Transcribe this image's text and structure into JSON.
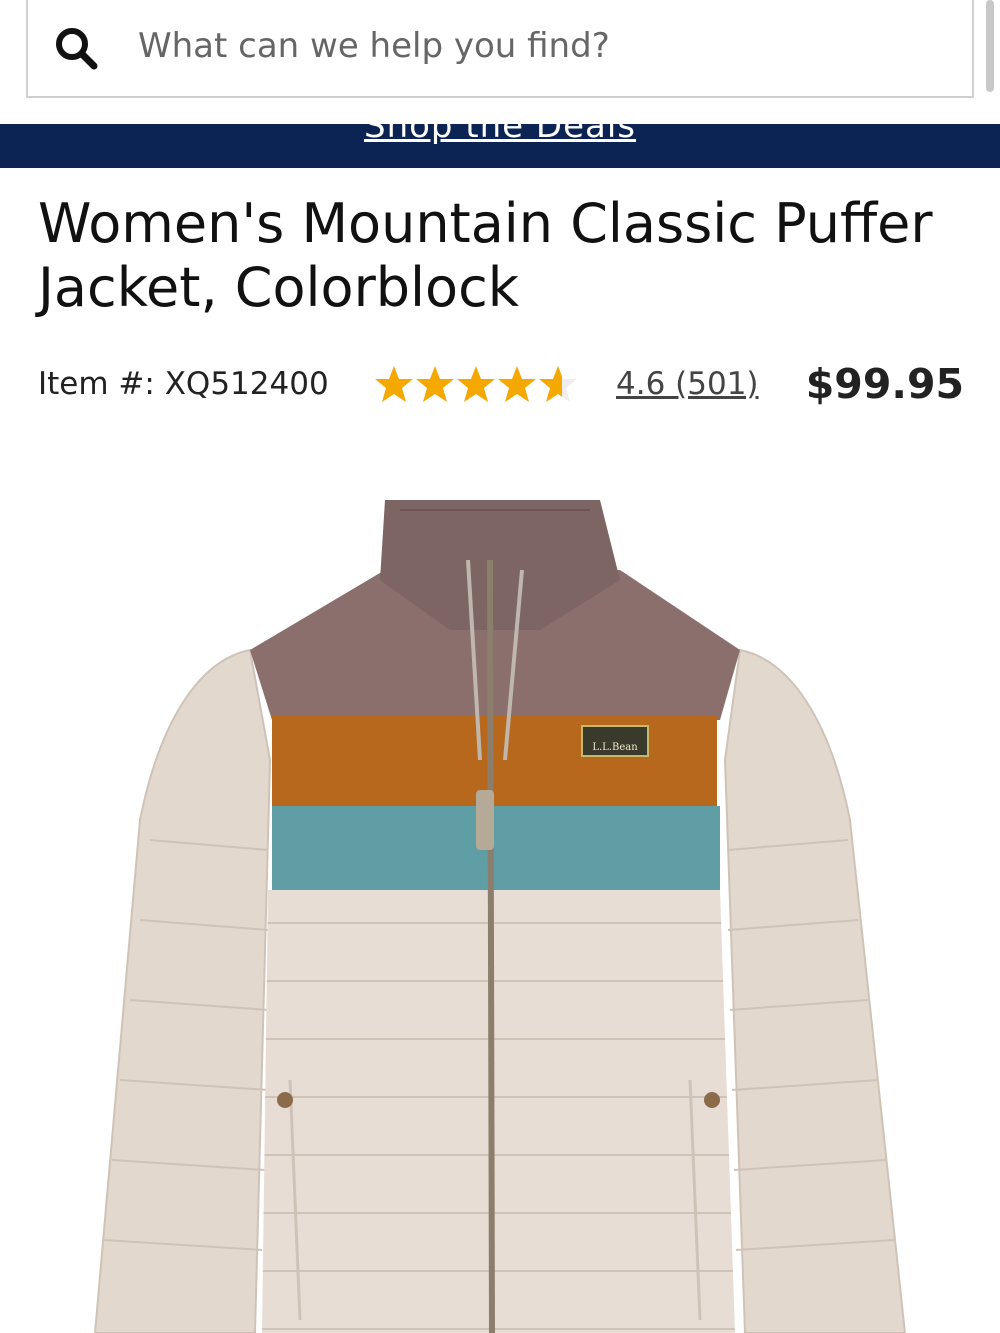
{
  "search": {
    "placeholder": "What can we help you find?",
    "icon": "search-icon"
  },
  "promo_bar": {
    "link_text": "Shop the Deals",
    "background": "#0c2453"
  },
  "product": {
    "title": "Women's Mountain Classic Puffer Jacket, Colorblock",
    "item_number": "Item #: XQ512400",
    "rating": {
      "value": 4.6,
      "max": 5,
      "review_count": 501,
      "label": "4.6 (501)",
      "star_color": "#f5a800"
    },
    "price": "$99.95",
    "image": {
      "logo_text": "L.L.Bean",
      "colors": {
        "collar": "#7d6563",
        "yoke": "#8a6f6c",
        "stripe_orange": "#b8681c",
        "stripe_teal": "#5f9ea5",
        "body": "#e7ddd4"
      }
    }
  }
}
